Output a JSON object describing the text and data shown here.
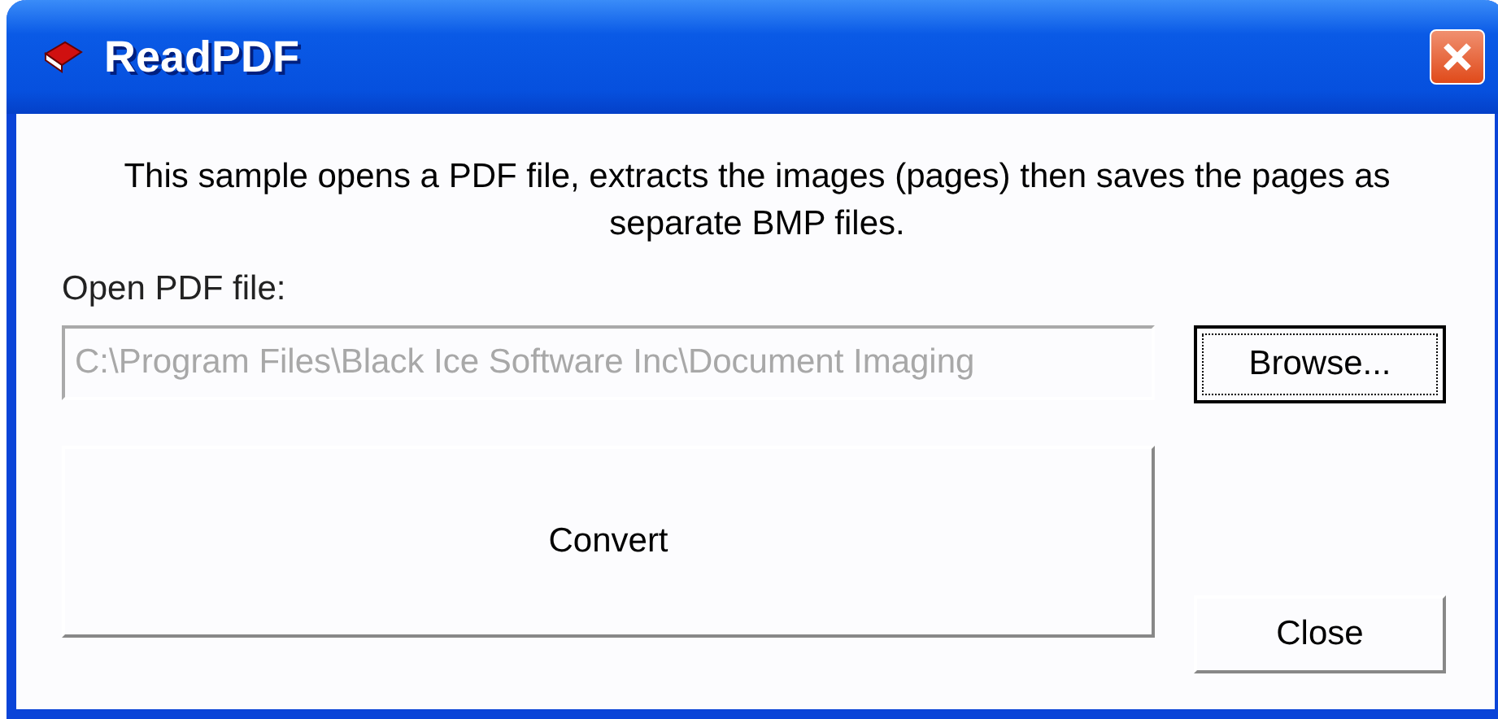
{
  "window": {
    "title": "ReadPDF"
  },
  "description": "This sample opens a PDF file, extracts the images (pages) then saves the pages as separate BMP files.",
  "file_field": {
    "label": "Open PDF file:",
    "value": "C:\\Program Files\\Black Ice Software Inc\\Document Imaging",
    "disabled": true
  },
  "buttons": [
    {
      "kind": "browse",
      "label": "Browse...",
      "focused": true
    },
    {
      "kind": "convert",
      "label": "Convert",
      "focused": false
    },
    {
      "kind": "close",
      "label": "Close",
      "focused": false
    }
  ]
}
